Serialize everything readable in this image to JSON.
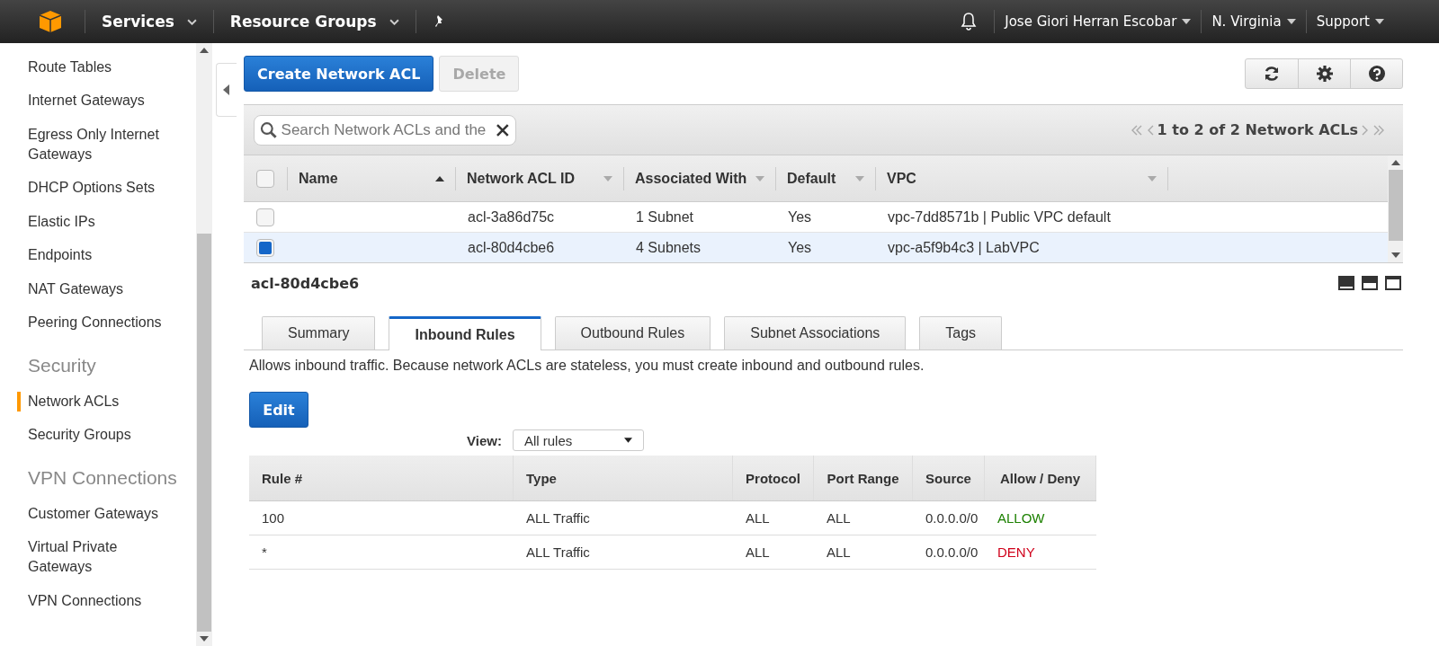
{
  "top_nav": {
    "menus": [
      {
        "label": "Services"
      },
      {
        "label": "Resource Groups"
      }
    ],
    "account": "Jose Giori Herran Escobar",
    "region": "N. Virginia",
    "support": "Support"
  },
  "sidebar": {
    "items": [
      {
        "kind": "link",
        "label": "Route Tables",
        "selected": false
      },
      {
        "kind": "link",
        "label": "Internet Gateways",
        "selected": false
      },
      {
        "kind": "link",
        "label": "Egress Only Internet Gateways",
        "selected": false
      },
      {
        "kind": "link",
        "label": "DHCP Options Sets",
        "selected": false
      },
      {
        "kind": "link",
        "label": "Elastic IPs",
        "selected": false
      },
      {
        "kind": "link",
        "label": "Endpoints",
        "selected": false
      },
      {
        "kind": "link",
        "label": "NAT Gateways",
        "selected": false
      },
      {
        "kind": "link",
        "label": "Peering Connections",
        "selected": false
      },
      {
        "kind": "heading",
        "label": "Security"
      },
      {
        "kind": "link",
        "label": "Network ACLs",
        "selected": true
      },
      {
        "kind": "link",
        "label": "Security Groups",
        "selected": false
      },
      {
        "kind": "heading",
        "label": "VPN Connections"
      },
      {
        "kind": "link",
        "label": "Customer Gateways",
        "selected": false
      },
      {
        "kind": "link",
        "label": "Virtual Private Gateways",
        "selected": false
      },
      {
        "kind": "link",
        "label": "VPN Connections",
        "selected": false
      }
    ]
  },
  "actions": {
    "create_button": "Create Network ACL",
    "delete_button": {
      "label": "Delete",
      "disabled": true
    }
  },
  "search": {
    "placeholder": "Search Network ACLs and the"
  },
  "pagination": "1 to 2 of 2 Network ACLs",
  "table": {
    "select_all": {
      "checked": false
    },
    "columns": [
      {
        "label": "Name",
        "sorted": true
      },
      {
        "label": "Network ACL ID",
        "sorted": false
      },
      {
        "label": "Associated With",
        "sorted": false
      },
      {
        "label": "Default",
        "sorted": false
      },
      {
        "label": "VPC",
        "sorted": false
      }
    ],
    "rows": [
      {
        "selected": false,
        "cells": [
          "",
          "acl-3a86d75c",
          "1 Subnet",
          "Yes",
          "vpc-7dd8571b | Public VPC default"
        ]
      },
      {
        "selected": true,
        "cells": [
          "",
          "acl-80d4cbe6",
          "4 Subnets",
          "Yes",
          "vpc-a5f9b4c3 | LabVPC"
        ]
      }
    ]
  },
  "detail": {
    "title": "acl-80d4cbe6",
    "tabs": [
      {
        "label": "Summary",
        "selected": false
      },
      {
        "label": "Inbound Rules",
        "selected": true
      },
      {
        "label": "Outbound Rules",
        "selected": false
      },
      {
        "label": "Subnet Associations",
        "selected": false
      },
      {
        "label": "Tags",
        "selected": false
      }
    ],
    "description": "Allows inbound traffic. Because network ACLs are stateless, you must create inbound and outbound rules.",
    "edit_button": "Edit",
    "view": {
      "label": "View:",
      "value": "All rules"
    },
    "rules": {
      "columns": [
        "Rule #",
        "Type",
        "Protocol",
        "Port Range",
        "Source",
        "Allow / Deny"
      ],
      "rows": [
        {
          "cells": [
            "100",
            "ALL Traffic",
            "ALL",
            "ALL",
            "0.0.0.0/0"
          ],
          "action": "ALLOW",
          "color": "#1d8102"
        },
        {
          "cells": [
            "*",
            "ALL Traffic",
            "ALL",
            "ALL",
            "0.0.0.0/0"
          ],
          "action": "DENY",
          "color": "#d0021b"
        }
      ]
    }
  }
}
